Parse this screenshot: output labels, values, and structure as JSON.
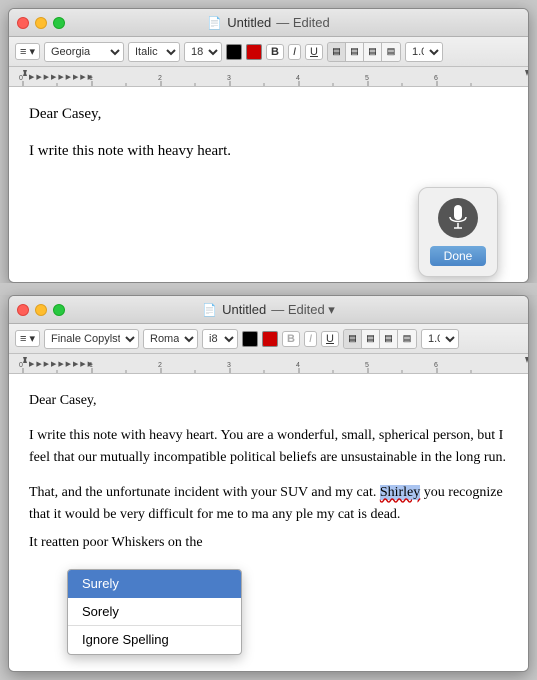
{
  "window1": {
    "title": "Untitled",
    "subtitle": "Edited",
    "toolbar": {
      "list_btn": "≡",
      "font": "Georgia",
      "style": "Italic",
      "size": "18",
      "bold": "B",
      "italic": "I",
      "underline": "U",
      "align_left": "≡",
      "align_center": "≡",
      "align_right": "≡",
      "align_justify": "≡",
      "spacing": "1.0"
    },
    "content": {
      "line1": "Dear Casey,",
      "line2": "I write this note with heavy heart."
    },
    "voice_btn": {
      "done_label": "Done"
    }
  },
  "window2": {
    "title": "Untitled",
    "subtitle": "Edited",
    "toolbar": {
      "font": "Finale Copylst T...",
      "style": "Roman",
      "size": "i8",
      "bold": "B",
      "italic": "I",
      "underline": "U",
      "spacing": "1.0"
    },
    "content": {
      "line1": "Dear Casey,",
      "line2": "I write this note with heavy heart. You are a wonderful, small, spherical person, but I feel that our mutually incompatible political beliefs are unsustainable in the long run.",
      "line3": "That, and the unfortunate incident with your SUV and my cat. Shirley you recognize that it would be very difficult for me to ma any p",
      "line3_cont": "le my cat is dead.",
      "line4": "It rea",
      "line4_cont": "tten poor Whiskers on the"
    },
    "spell_popup": {
      "item1": "Surely",
      "item2": "Sorely",
      "item3": "Ignore Spelling"
    }
  },
  "colors": {
    "accent": "#4a7dc8",
    "red_traffic": "#ff5f57",
    "yellow_traffic": "#ffbd2e",
    "green_traffic": "#28c840"
  }
}
